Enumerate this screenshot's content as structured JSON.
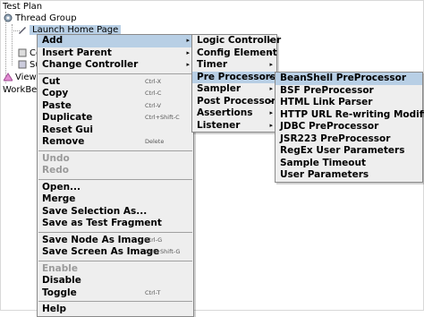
{
  "tree": {
    "test_plan": "Test Plan",
    "thread_group": "Thread Group",
    "launch_home_page": "Launch Home Page",
    "co_partial": "Co",
    "su_partial": "Su",
    "view_partial": "View",
    "workbench_partial": "WorkBen"
  },
  "context_menu": {
    "groups": [
      [
        {
          "label": "Add",
          "accel": "",
          "submenu": true,
          "highlight": true,
          "disabled": false
        },
        {
          "label": "Insert Parent",
          "accel": "",
          "submenu": true,
          "highlight": false,
          "disabled": false
        },
        {
          "label": "Change Controller",
          "accel": "",
          "submenu": true,
          "highlight": false,
          "disabled": false
        }
      ],
      [
        {
          "label": "Cut",
          "accel": "Ctrl-X",
          "submenu": false,
          "highlight": false,
          "disabled": false
        },
        {
          "label": "Copy",
          "accel": "Ctrl-C",
          "submenu": false,
          "highlight": false,
          "disabled": false
        },
        {
          "label": "Paste",
          "accel": "Ctrl-V",
          "submenu": false,
          "highlight": false,
          "disabled": false
        },
        {
          "label": "Duplicate",
          "accel": "Ctrl+Shift-C",
          "submenu": false,
          "highlight": false,
          "disabled": false
        },
        {
          "label": "Reset Gui",
          "accel": "",
          "submenu": false,
          "highlight": false,
          "disabled": false
        },
        {
          "label": "Remove",
          "accel": "Delete",
          "submenu": false,
          "highlight": false,
          "disabled": false
        }
      ],
      [
        {
          "label": "Undo",
          "accel": "",
          "submenu": false,
          "highlight": false,
          "disabled": true
        },
        {
          "label": "Redo",
          "accel": "",
          "submenu": false,
          "highlight": false,
          "disabled": true
        }
      ],
      [
        {
          "label": "Open...",
          "accel": "",
          "submenu": false,
          "highlight": false,
          "disabled": false
        },
        {
          "label": "Merge",
          "accel": "",
          "submenu": false,
          "highlight": false,
          "disabled": false
        },
        {
          "label": "Save Selection As...",
          "accel": "",
          "submenu": false,
          "highlight": false,
          "disabled": false
        },
        {
          "label": "Save as Test Fragment",
          "accel": "",
          "submenu": false,
          "highlight": false,
          "disabled": false
        }
      ],
      [
        {
          "label": "Save Node As Image",
          "accel": "Ctrl-G",
          "submenu": false,
          "highlight": false,
          "disabled": false
        },
        {
          "label": "Save Screen As Image",
          "accel": "Ctrl+Shift-G",
          "submenu": false,
          "highlight": false,
          "disabled": false
        }
      ],
      [
        {
          "label": "Enable",
          "accel": "",
          "submenu": false,
          "highlight": false,
          "disabled": true
        },
        {
          "label": "Disable",
          "accel": "",
          "submenu": false,
          "highlight": false,
          "disabled": false
        },
        {
          "label": "Toggle",
          "accel": "Ctrl-T",
          "submenu": false,
          "highlight": false,
          "disabled": false
        }
      ],
      [
        {
          "label": "Help",
          "accel": "",
          "submenu": false,
          "highlight": false,
          "disabled": false
        }
      ]
    ]
  },
  "add_submenu": [
    {
      "label": "Logic Controller",
      "highlight": false
    },
    {
      "label": "Config Element",
      "highlight": false
    },
    {
      "label": "Timer",
      "highlight": false
    },
    {
      "label": "Pre Processors",
      "highlight": true
    },
    {
      "label": "Sampler",
      "highlight": false
    },
    {
      "label": "Post Processors",
      "highlight": false
    },
    {
      "label": "Assertions",
      "highlight": false
    },
    {
      "label": "Listener",
      "highlight": false
    }
  ],
  "pre_processors_submenu": [
    {
      "label": "BeanShell PreProcessor",
      "highlight": true
    },
    {
      "label": "BSF PreProcessor",
      "highlight": false
    },
    {
      "label": "HTML Link Parser",
      "highlight": false
    },
    {
      "label": "HTTP URL Re-writing Modifier",
      "highlight": false
    },
    {
      "label": "JDBC PreProcessor",
      "highlight": false
    },
    {
      "label": "JSR223 PreProcessor",
      "highlight": false
    },
    {
      "label": "RegEx User Parameters",
      "highlight": false
    },
    {
      "label": "Sample Timeout",
      "highlight": false
    },
    {
      "label": "User Parameters",
      "highlight": false
    }
  ],
  "colors": {
    "menu_bg": "#eeeeee",
    "highlight": "#b8cfe5",
    "disabled_text": "#9a9a9a"
  },
  "icons": {
    "arrow": "▸",
    "test_plan": "test-plan-icon",
    "thread_group": "thread-group-icon",
    "sampler": "sampler-icon"
  }
}
